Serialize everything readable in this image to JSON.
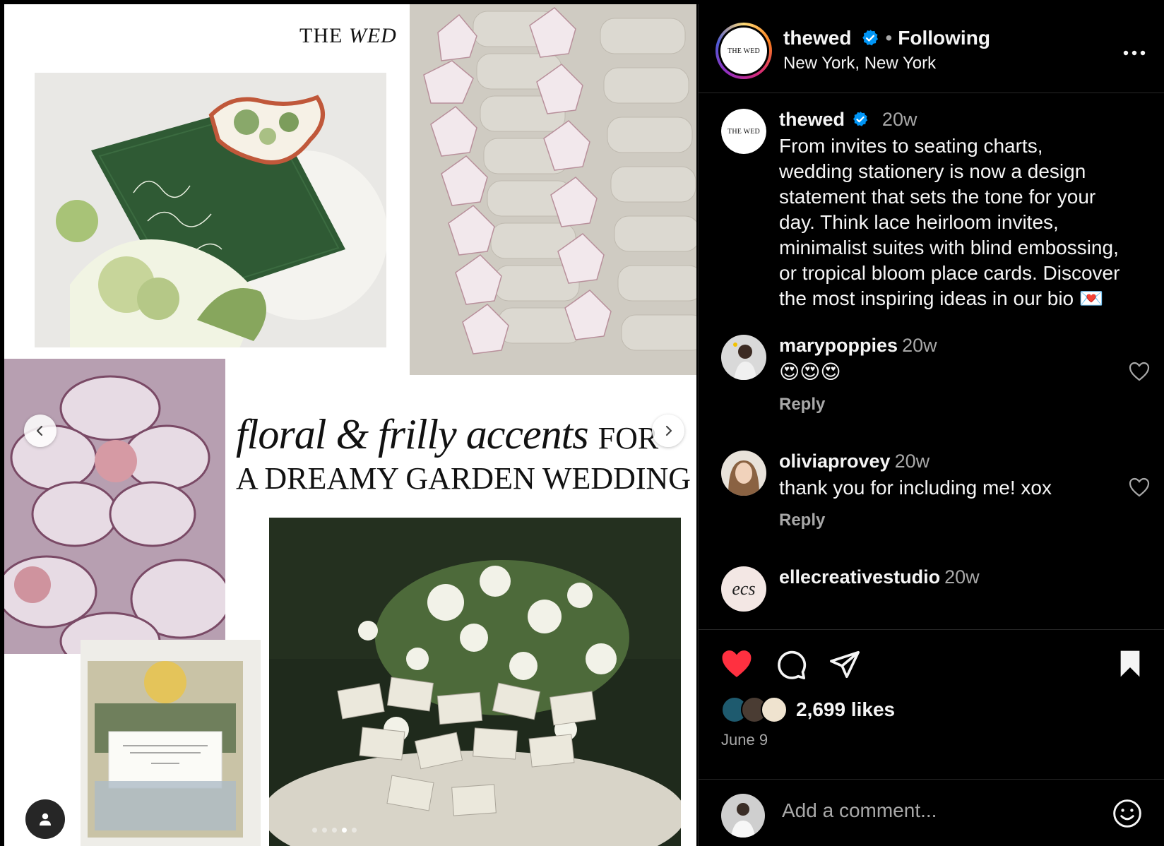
{
  "post": {
    "brand_word1": "THE",
    "brand_word2": "WED",
    "headline_script": "floral & frilly accents",
    "headline_for": "FOR",
    "headline_line2": "A DREAMY GARDEN WEDDING",
    "carousel_total": 5,
    "carousel_active": 4
  },
  "header": {
    "username": "thewed",
    "separator": "•",
    "follow_status": "Following",
    "location": "New York, New York",
    "avatar_text": "THE WED"
  },
  "caption": {
    "username": "thewed",
    "time": "20w",
    "text": "From invites to seating charts, wedding stationery is now a design statement that sets the tone for your day. Think lace heirloom invites, minimalist suites with blind embossing, or tropical bloom place cards. Discover the most inspiring ideas in our bio 💌"
  },
  "comments": [
    {
      "username": "marypoppies",
      "time": "20w",
      "text": "😍😍😍",
      "reply": "Reply"
    },
    {
      "username": "oliviaprovey",
      "time": "20w",
      "text": "thank you for including me! xox",
      "reply": "Reply"
    },
    {
      "username": "ellecreativestudio",
      "time": "20w",
      "text": "",
      "reply": "",
      "avatar_text": "ecs"
    }
  ],
  "actions": {
    "likes": "2,699 likes",
    "date": "June 9",
    "comment_placeholder": "Add a comment..."
  },
  "colors": {
    "background": "#000000",
    "text": "#f5f5f5",
    "muted": "#a8a8a8",
    "verified": "#0095f6",
    "like_red": "#ff3040",
    "divider": "#262626"
  },
  "icons": [
    "verified-badge-icon",
    "more-options-icon",
    "heart-outline-icon",
    "heart-filled-icon",
    "comment-icon",
    "share-icon",
    "bookmark-filled-icon",
    "emoji-icon",
    "chevron-left-icon",
    "chevron-right-icon",
    "person-icon"
  ]
}
